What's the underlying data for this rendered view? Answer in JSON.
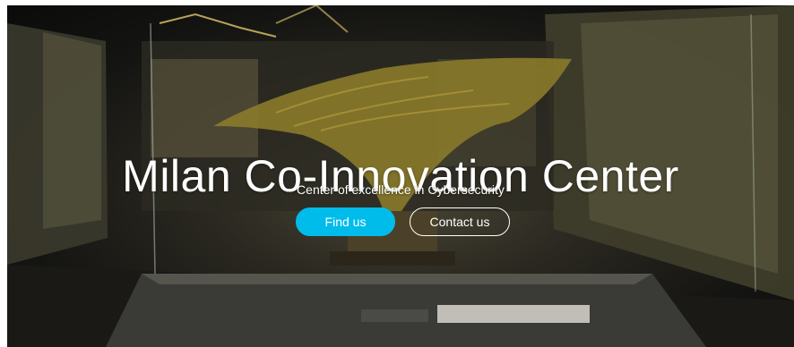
{
  "hero": {
    "title": "Milan Co-Innovation Center",
    "subtitle": "Center of excellence in Cybersecurity",
    "primary_button_label": "Find us",
    "secondary_button_label": "Contact us"
  },
  "colors": {
    "primary_button": "#00bceb",
    "text": "#ffffff"
  }
}
